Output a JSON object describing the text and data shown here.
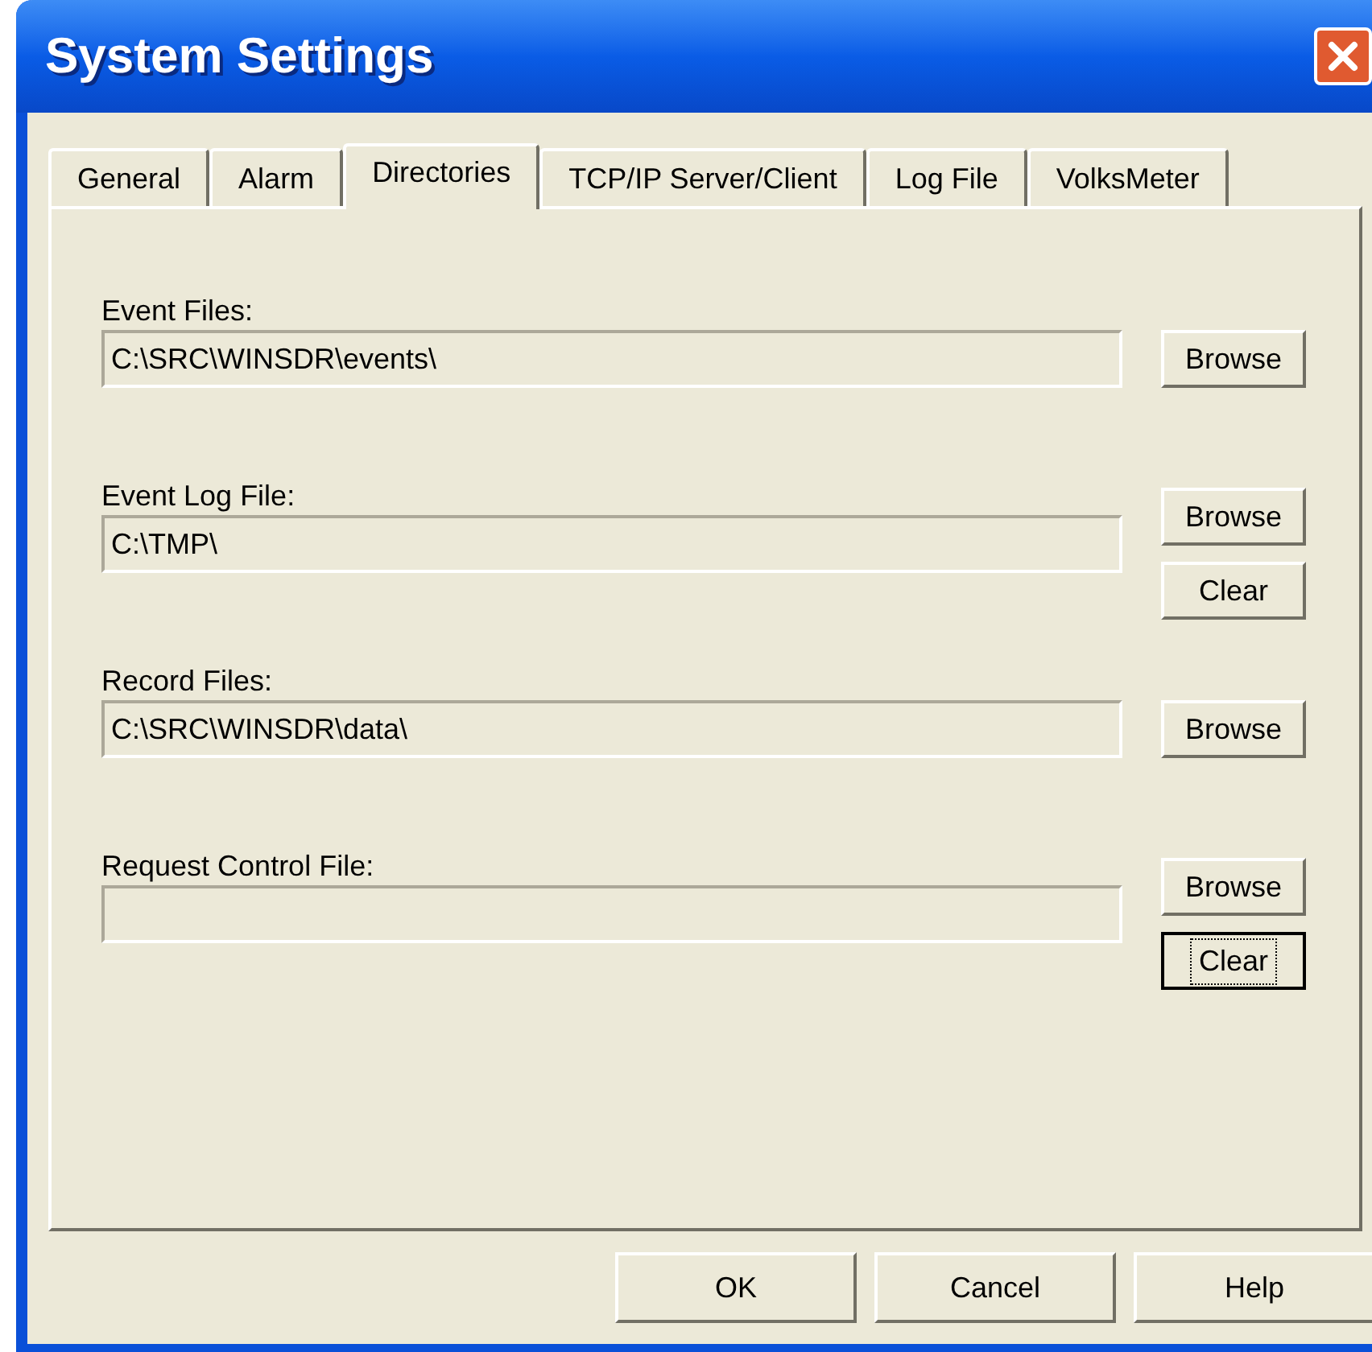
{
  "window": {
    "title": "System Settings"
  },
  "tabs": [
    {
      "label": "General",
      "selected": false
    },
    {
      "label": "Alarm",
      "selected": false
    },
    {
      "label": "Directories",
      "selected": true
    },
    {
      "label": "TCP/IP Server/Client",
      "selected": false
    },
    {
      "label": "Log File",
      "selected": false
    },
    {
      "label": "VolksMeter",
      "selected": false
    }
  ],
  "directories": [
    {
      "label": "Event Files:",
      "value": "C:\\SRC\\WINSDR\\events\\",
      "buttons": [
        {
          "label": "Browse",
          "focused": false
        }
      ]
    },
    {
      "label": "Event Log File:",
      "value": "C:\\TMP\\",
      "buttons": [
        {
          "label": "Browse",
          "focused": false
        },
        {
          "label": "Clear",
          "focused": false
        }
      ]
    },
    {
      "label": "Record Files:",
      "value": "C:\\SRC\\WINSDR\\data\\",
      "buttons": [
        {
          "label": "Browse",
          "focused": false
        }
      ]
    },
    {
      "label": "Request Control File:",
      "buttons": [
        {
          "label": "Browse",
          "focused": false
        },
        {
          "label": "Clear",
          "focused": true
        }
      ]
    }
  ],
  "buttons": [
    {
      "label": "OK"
    },
    {
      "label": "Cancel"
    },
    {
      "label": "Help"
    }
  ]
}
